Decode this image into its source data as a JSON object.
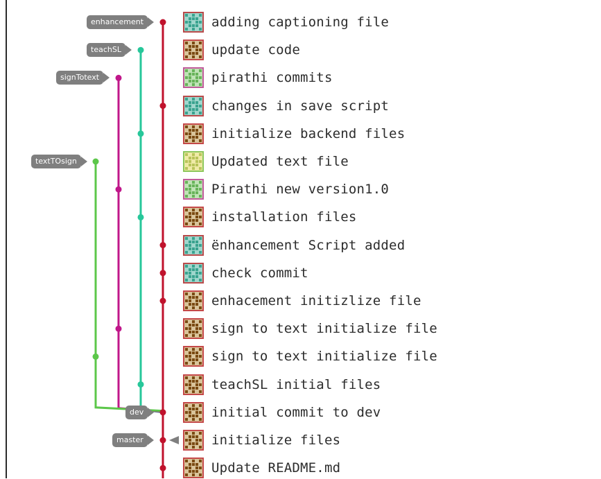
{
  "colors": {
    "enhancement": "#c0122c",
    "teachSL": "#27c79a",
    "signTotext": "#c0178a",
    "textTOsign": "#5cc74a",
    "tag_bg": "#7f7f7f"
  },
  "branch_tags": [
    {
      "id": "enhancement",
      "label": "enhancement",
      "row": 0,
      "lane": "enhancement"
    },
    {
      "id": "teachSL",
      "label": "teachSL",
      "row": 1,
      "lane": "teachSL"
    },
    {
      "id": "signTotext",
      "label": "signTotext",
      "row": 2,
      "lane": "signTotext"
    },
    {
      "id": "textTOsign",
      "label": "textTOsign",
      "row": 5,
      "lane": "textTOsign"
    },
    {
      "id": "dev",
      "label": "dev",
      "row": 14,
      "lane": "enhancement"
    },
    {
      "id": "master",
      "label": "master",
      "row": 15,
      "lane": "enhancement"
    }
  ],
  "commits": [
    {
      "message": "adding captioning file",
      "avatar": "teal-avatar-icon",
      "lane": "enhancement"
    },
    {
      "message": "update code",
      "avatar": "brown-avatar-icon",
      "lane": "teachSL"
    },
    {
      "message": "pirathi commits",
      "avatar": "green-avatar-icon",
      "lane": "signTotext"
    },
    {
      "message": "changes in save script",
      "avatar": "teal-avatar-icon",
      "lane": "enhancement"
    },
    {
      "message": "initialize backend files",
      "avatar": "brown-avatar-icon",
      "lane": "teachSL"
    },
    {
      "message": "Updated text file",
      "avatar": "yellow-avatar-icon",
      "lane": "textTOsign"
    },
    {
      "message": "Pirathi new version1.0",
      "avatar": "green-avatar-icon",
      "lane": "signTotext"
    },
    {
      "message": "installation files",
      "avatar": "brown-avatar-icon",
      "lane": "teachSL"
    },
    {
      "message": "ënhancement Script added",
      "avatar": "teal-avatar-icon",
      "lane": "enhancement"
    },
    {
      "message": "check commit",
      "avatar": "teal-avatar-icon",
      "lane": "enhancement"
    },
    {
      "message": "enhacement initizlize file",
      "avatar": "brown-avatar-icon",
      "lane": "enhancement"
    },
    {
      "message": "sign to text initialize file",
      "avatar": "brown-avatar-icon",
      "lane": "signTotext"
    },
    {
      "message": "sign to text initialize file",
      "avatar": "brown-avatar-icon",
      "lane": "textTOsign"
    },
    {
      "message": "teachSL initial files",
      "avatar": "brown-avatar-icon",
      "lane": "teachSL"
    },
    {
      "message": "initial commit to dev",
      "avatar": "brown-avatar-icon",
      "lane": "enhancement"
    },
    {
      "message": "initialize files",
      "avatar": "brown-avatar-icon",
      "lane": "enhancement"
    },
    {
      "message": "Update README.md",
      "avatar": "brown-avatar-icon",
      "lane": "enhancement"
    }
  ]
}
